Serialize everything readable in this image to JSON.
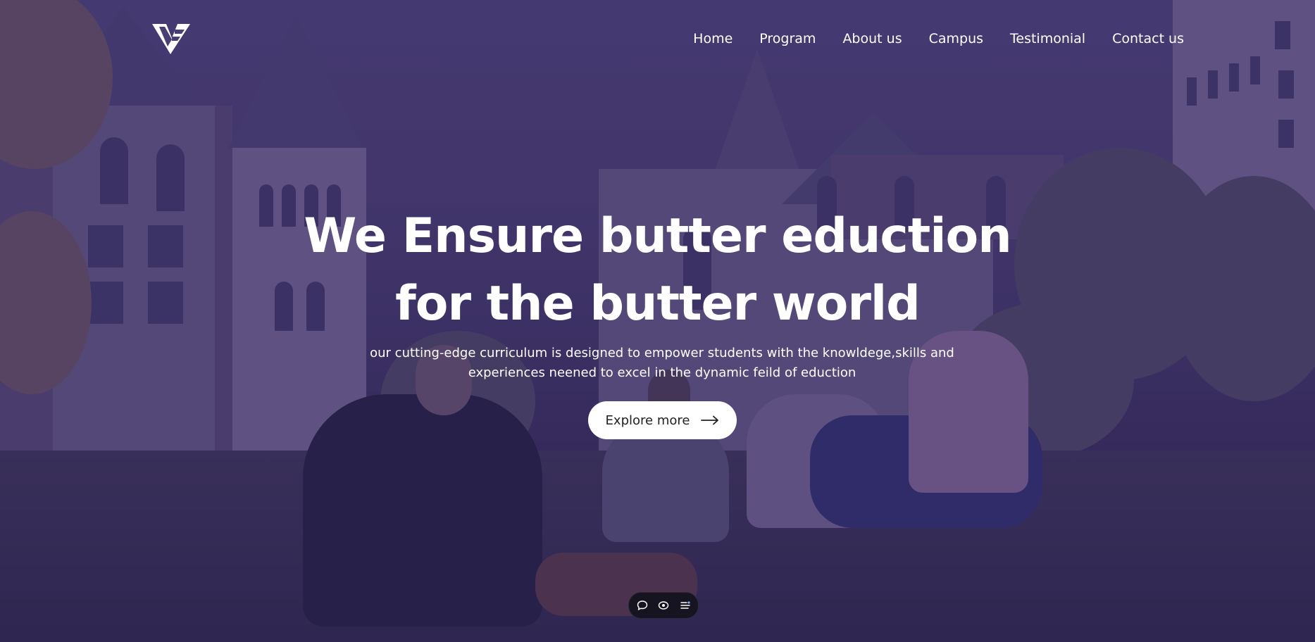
{
  "nav": {
    "items": [
      {
        "label": "Home"
      },
      {
        "label": "Program"
      },
      {
        "label": "About us"
      },
      {
        "label": "Campus"
      },
      {
        "label": "Testimonial"
      },
      {
        "label": "Contact us"
      }
    ]
  },
  "hero": {
    "headline_line1": "We Ensure butter eduction",
    "headline_line2": "for the butter world",
    "subtext_line1": "our cutting-edge curriculum is designed to empower students with the knowldege,skills and",
    "subtext_line2": "experiences neened to excel in the dynamic feild of eduction",
    "cta_label": "Explore more",
    "cta_icon": "arrow-right-icon"
  },
  "floating_toolbar": {
    "icons": [
      "comment-icon",
      "eye-icon",
      "settings-list-icon"
    ]
  },
  "colors": {
    "overlay": "#3f2f78",
    "text": "#ffffff",
    "button_bg": "#ffffff",
    "button_text": "#222222",
    "toolbar_bg": "#161420"
  }
}
